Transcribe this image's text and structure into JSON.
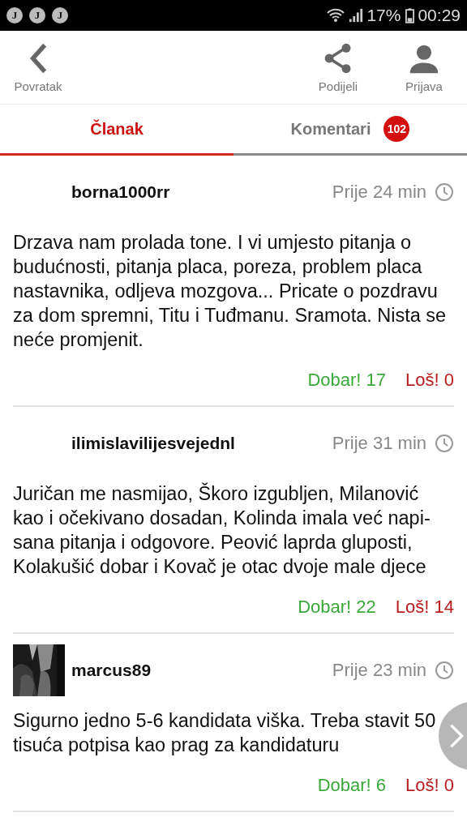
{
  "status_bar": {
    "notifications": [
      "J",
      "J",
      "J"
    ],
    "battery": "17%",
    "time": "00:29"
  },
  "toolbar": {
    "back": "Povratak",
    "share": "Podijeli",
    "login": "Prijava"
  },
  "tabs": [
    {
      "label": "Članak",
      "selected": true
    },
    {
      "label": "Komentari",
      "selected": false,
      "badge": "102"
    }
  ],
  "comments": [
    {
      "user": "borna1000rr",
      "has_avatar": false,
      "time": "Prije 24 min",
      "text": "Drzava nam prolada tone. I vi umjesto pitanja o budućnosti, pitanja placa, poreza, problem placa nastavnika, odljeva mozgova... Pricate o pozdravu za dom spremni, Titu i Tuđmanu. Sramota. Nista se neće promjenit.",
      "good": "Dobar! 17",
      "bad": "Loš! 0"
    },
    {
      "user": "ilimislavilijesvejednl",
      "has_avatar": false,
      "time": "Prije 31 min",
      "text": "Juričan me nasmijao, Škoro izgubljen, Milanović kao i očekivano dosadan, Kolinda imala već napi-sana pitanja i odgovore. Peović laprda gluposti, Kolakušić dobar i Kovač je otac dvoje male djece",
      "good": "Dobar! 22",
      "bad": "Loš! 14"
    },
    {
      "user": "marcus89",
      "has_avatar": true,
      "time": "Prije 23 min",
      "text": "Sigurno jedno 5-6 kandidata viška. Treba stavit 50 tisuća potpisa kao prag za kandidaturu",
      "good": "Dobar! 6",
      "bad": "Loš! 0"
    }
  ]
}
